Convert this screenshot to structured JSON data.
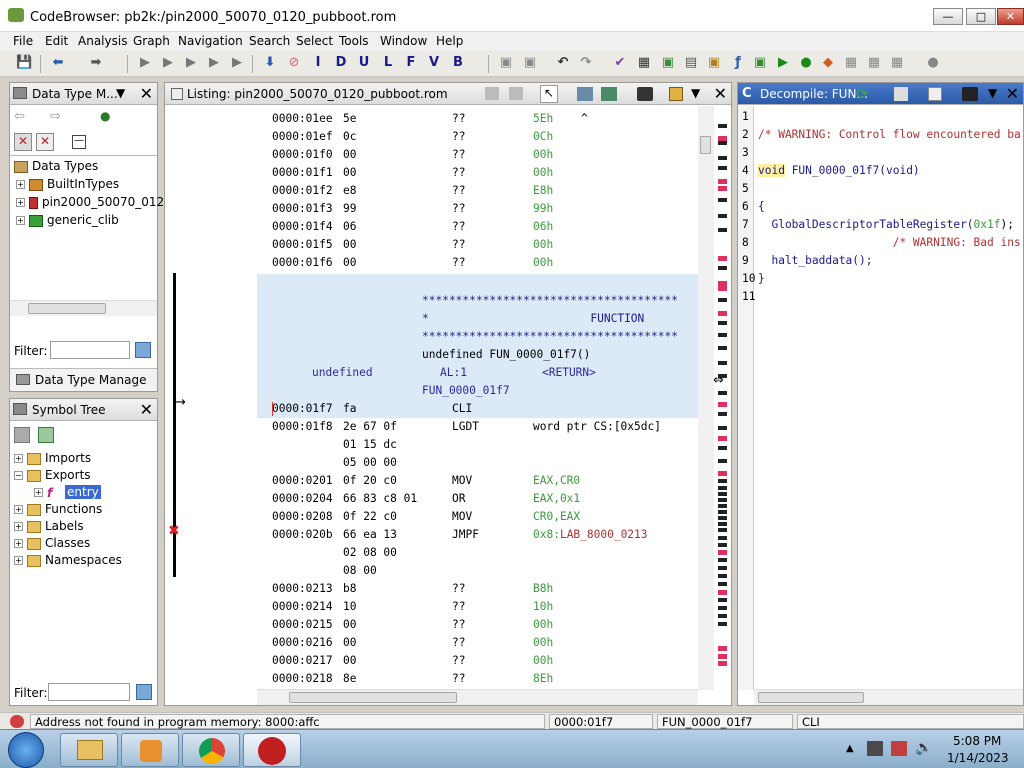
{
  "window": {
    "title": "CodeBrowser: pb2k:/pin2000_50070_0120_pubboot.rom"
  },
  "menubar": [
    "File",
    "Edit",
    "Analysis",
    "Graph",
    "Navigation",
    "Search",
    "Select",
    "Tools",
    "Window",
    "Help"
  ],
  "toolbar": {
    "letters": [
      "I",
      "D",
      "U",
      "L",
      "F",
      "V",
      "B"
    ]
  },
  "data_type_panel": {
    "title": "Data Type M...",
    "root": "Data Types",
    "items": [
      "BuiltInTypes",
      "pin2000_50070_012",
      "generic_clib"
    ],
    "filter_label": "Filter:",
    "tab_label": "Data Type Manage"
  },
  "symbol_tree": {
    "title": "Symbol Tree",
    "items": [
      "Imports",
      "Exports",
      "entry",
      "Functions",
      "Labels",
      "Classes",
      "Namespaces"
    ],
    "filter_label": "Filter:"
  },
  "listing": {
    "title": "Listing:  pin2000_50070_0120_pubboot.rom",
    "rows1": [
      {
        "addr": "0000:01ee",
        "byte": "5e",
        "op": "??",
        "val": "5Eh",
        "extra": "^"
      },
      {
        "addr": "0000:01ef",
        "byte": "0c",
        "op": "??",
        "val": "0Ch",
        "extra": ""
      },
      {
        "addr": "0000:01f0",
        "byte": "00",
        "op": "??",
        "val": "00h",
        "extra": ""
      },
      {
        "addr": "0000:01f1",
        "byte": "00",
        "op": "??",
        "val": "00h",
        "extra": ""
      },
      {
        "addr": "0000:01f2",
        "byte": "e8",
        "op": "??",
        "val": "E8h",
        "extra": ""
      },
      {
        "addr": "0000:01f3",
        "byte": "99",
        "op": "??",
        "val": "99h",
        "extra": ""
      },
      {
        "addr": "0000:01f4",
        "byte": "06",
        "op": "??",
        "val": "06h",
        "extra": ""
      },
      {
        "addr": "0000:01f5",
        "byte": "00",
        "op": "??",
        "val": "00h",
        "extra": ""
      },
      {
        "addr": "0000:01f6",
        "byte": "00",
        "op": "??",
        "val": "00h",
        "extra": ""
      }
    ],
    "stars": "**************************************",
    "star_line": "*                        FUNCTION",
    "sig": "undefined FUN_0000_01f7()",
    "ret_type": "undefined",
    "ret_reg": "AL:1",
    "ret_label": "<RETURN>",
    "func_label": "FUN_0000_01f7",
    "rows2": [
      {
        "addr": "0000:01f7",
        "bytes": "fa",
        "op": "CLI",
        "arg": ""
      },
      {
        "addr": "0000:01f8",
        "bytes": "2e 67 0f",
        "op": "LGDT",
        "arg": "word ptr CS:[0x5dc]"
      },
      {
        "addr": "",
        "bytes": "01 15 dc",
        "op": "",
        "arg": ""
      },
      {
        "addr": "",
        "bytes": "05 00 00",
        "op": "",
        "arg": ""
      },
      {
        "addr": "0000:0201",
        "bytes": "0f 20 c0",
        "op": "MOV",
        "arg": "EAX,CR0"
      },
      {
        "addr": "0000:0204",
        "bytes": "66 83 c8 01",
        "op": "OR",
        "arg": "EAX,0x1"
      },
      {
        "addr": "0000:0208",
        "bytes": "0f 22 c0",
        "op": "MOV",
        "arg": "CR0,EAX"
      },
      {
        "addr": "0000:020b",
        "bytes": "66 ea 13",
        "op": "JMPF",
        "arg": "0x8:LAB_8000_0213"
      },
      {
        "addr": "",
        "bytes": "02 08 00",
        "op": "",
        "arg": ""
      },
      {
        "addr": "",
        "bytes": "08 00",
        "op": "",
        "arg": ""
      },
      {
        "addr": "0000:0213",
        "bytes": "b8",
        "op": "??",
        "arg": "B8h"
      },
      {
        "addr": "0000:0214",
        "bytes": "10",
        "op": "??",
        "arg": "10h"
      },
      {
        "addr": "0000:0215",
        "bytes": "00",
        "op": "??",
        "arg": "00h"
      },
      {
        "addr": "0000:0216",
        "bytes": "00",
        "op": "??",
        "arg": "00h"
      },
      {
        "addr": "0000:0217",
        "bytes": "00",
        "op": "??",
        "arg": "00h"
      },
      {
        "addr": "0000:0218",
        "bytes": "8e",
        "op": "??",
        "arg": "8Eh"
      }
    ]
  },
  "decompiler": {
    "title": "Decompile: FUN...",
    "line_numbers": [
      "1",
      "2",
      "3",
      "4",
      "5",
      "6",
      "7",
      "8",
      "9",
      "10",
      "11"
    ],
    "lines": [
      "",
      "/* WARNING: Control flow encountered ba",
      "",
      "void FUN_0000_01f7(void)",
      "",
      "{",
      "  GlobalDescriptorTableRegister(0x1f);",
      "                    /* WARNING: Bad ins",
      "  halt_baddata();",
      "}",
      ""
    ]
  },
  "status": {
    "message": "Address not found in program memory: 8000:affc",
    "address": "0000:01f7",
    "function": "FUN_0000_01f7",
    "instruction": "CLI"
  },
  "taskbar": {
    "time": "5:08 PM",
    "date": "1/14/2023"
  }
}
